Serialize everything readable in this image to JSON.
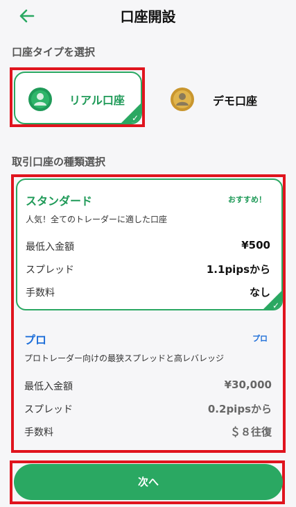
{
  "header": {
    "title": "口座開設",
    "back_icon": "arrow-left-icon"
  },
  "account_type": {
    "section_label": "口座タイプを選択",
    "real": {
      "label": "リアル口座",
      "icon": "user-coin-icon",
      "selected": true
    },
    "demo": {
      "label": "デモ口座",
      "icon": "user-coin-icon",
      "selected": false
    }
  },
  "plans": {
    "section_label": "取引口座の種類選択",
    "standard": {
      "name": "スタンダード",
      "badge": "おすすめ！",
      "description": "人気！全てのトレーダーに適した口座",
      "rows": [
        {
          "label": "最低入金額",
          "value": "¥500"
        },
        {
          "label": "スプレッド",
          "value": "1.1pipsから"
        },
        {
          "label": "手数料",
          "value": "なし"
        }
      ],
      "selected": true
    },
    "pro": {
      "name": "プロ",
      "badge": "プロ",
      "description": "プロトレーダー向けの最狭スプレッドと高レバレッジ",
      "rows": [
        {
          "label": "最低入金額",
          "value": "¥30,000"
        },
        {
          "label": "スプレッド",
          "value": "0.2pipsから"
        },
        {
          "label": "手数料",
          "value": "＄８往復"
        }
      ],
      "selected": false
    }
  },
  "footer": {
    "next_label": "次へ"
  },
  "colors": {
    "accent": "#2aa862",
    "accent_text": "#1f9a58",
    "pro_blue": "#1e6fd9",
    "highlight": "#e0141e",
    "gold": "#d6a93a"
  }
}
